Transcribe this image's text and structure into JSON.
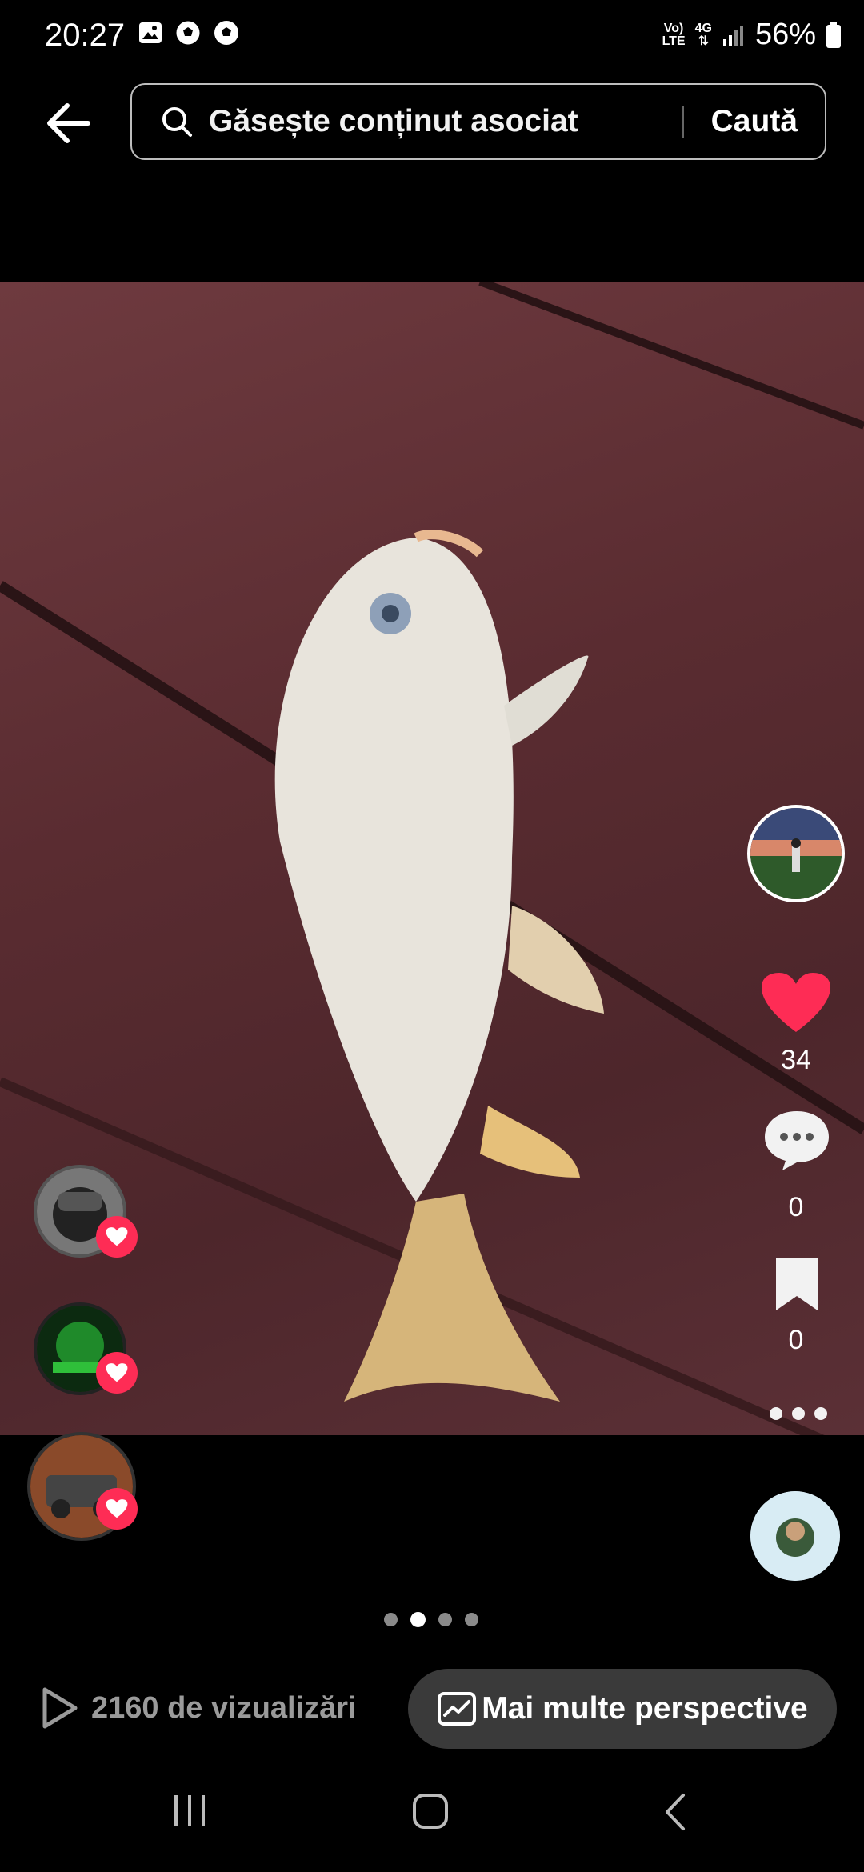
{
  "status_bar": {
    "time": "20:27",
    "battery": "56%",
    "network_top": "Vo)",
    "network_bottom": "LTE",
    "network_gen": "4G"
  },
  "search": {
    "placeholder": "Găsește conținut asociat",
    "submit_label": "Caută"
  },
  "post": {
    "likes": "34",
    "comments": "0",
    "saves": "0",
    "colors": {
      "like": "#fe2c55",
      "photo_bg": "#5a2c31"
    }
  },
  "pagination": {
    "total": 4,
    "active": 2
  },
  "bottom": {
    "views_label": "2160 de vizualizări",
    "insights_label": "Mai multe perspective"
  },
  "icons": [
    "back-arrow-icon",
    "search-icon",
    "heart-icon",
    "comment-icon",
    "bookmark-icon",
    "more-icon",
    "play-icon",
    "trending-icon",
    "recents-icon",
    "home-icon",
    "nav-back-icon"
  ]
}
